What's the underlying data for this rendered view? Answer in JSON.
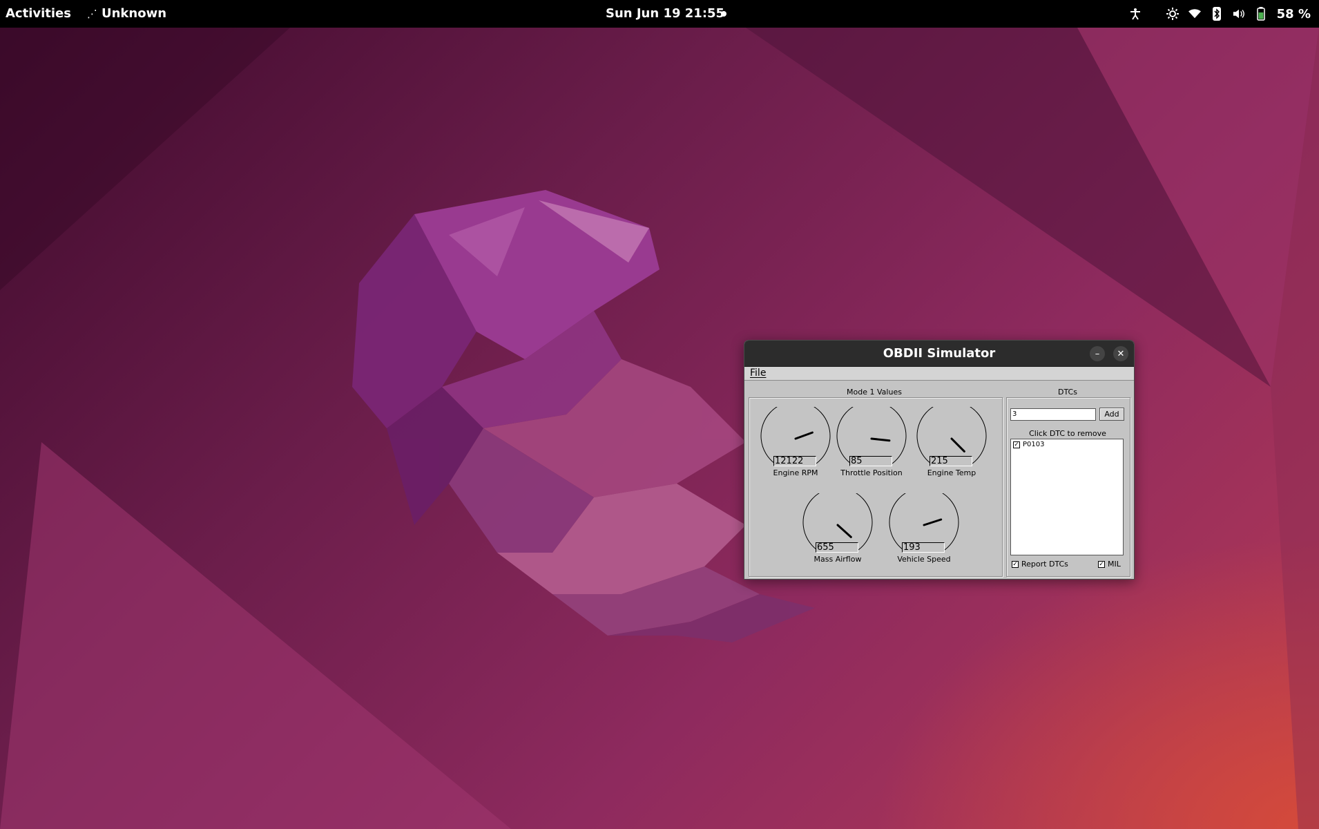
{
  "topbar": {
    "activities": "Activities",
    "app_name": "Unknown",
    "clock": "Sun Jun 19  21:55",
    "battery": "58 %",
    "icons": [
      "accessibility-icon",
      "brightness-icon",
      "wifi-icon",
      "bluetooth-icon",
      "volume-icon",
      "battery-icon"
    ]
  },
  "window": {
    "title": "OBDII Simulator",
    "menu": [
      "File"
    ],
    "mode1": {
      "title": "Mode 1 Values",
      "gauges": [
        {
          "label": "Engine RPM",
          "value": "12122",
          "needle_deg": 70
        },
        {
          "label": "Throttle Position",
          "value": "85",
          "needle_deg": 96
        },
        {
          "label": "Engine Temp",
          "value": "215",
          "needle_deg": 135
        },
        {
          "label": "Mass Airflow",
          "value": "655",
          "needle_deg": 132
        },
        {
          "label": "Vehicle Speed",
          "value": "193",
          "needle_deg": 72
        }
      ]
    },
    "dtcs": {
      "title": "DTCs",
      "input_value": "3",
      "add_label": "Add",
      "hint": "Click DTC to remove",
      "items": [
        {
          "code": "P0103",
          "checked": true
        }
      ],
      "report_label": "Report DTCs",
      "report_checked": true,
      "mil_label": "MIL",
      "mil_checked": true
    }
  },
  "colors": {
    "window_bg": "#c4c4c4",
    "titlebar_bg": "#2c2c2c",
    "topbar_bg": "#000000"
  }
}
